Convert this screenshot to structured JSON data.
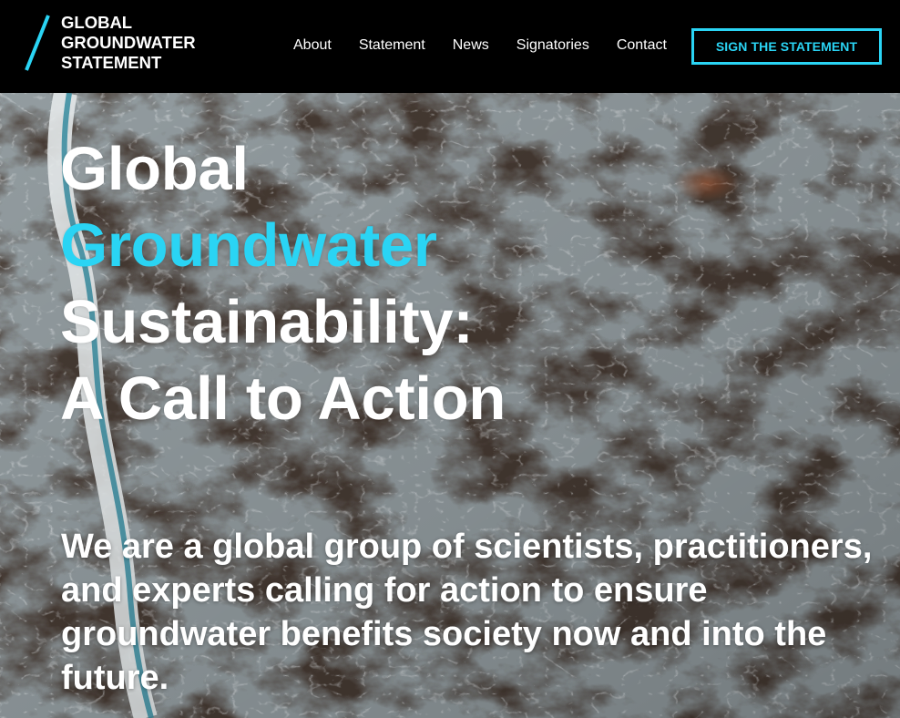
{
  "brand": {
    "logo_lines": [
      "GLOBAL",
      "GROUNDWATER",
      "STATEMENT"
    ],
    "accent_color": "#2ad4f4"
  },
  "nav": {
    "items": [
      {
        "label": "About"
      },
      {
        "label": "Statement"
      },
      {
        "label": "News"
      },
      {
        "label": "Signatories"
      },
      {
        "label": "Contact"
      }
    ],
    "cta_label": "SIGN THE STATEMENT"
  },
  "hero": {
    "title_lines": [
      "Global",
      "Groundwater",
      "Sustainability:",
      "A Call to Action"
    ],
    "highlight_line_index": 1,
    "description": "We are a global group of scientists, practitioners, and experts calling for action to ensure groundwater benefits society now and into the future.",
    "background": "aerial-landscape-image"
  }
}
